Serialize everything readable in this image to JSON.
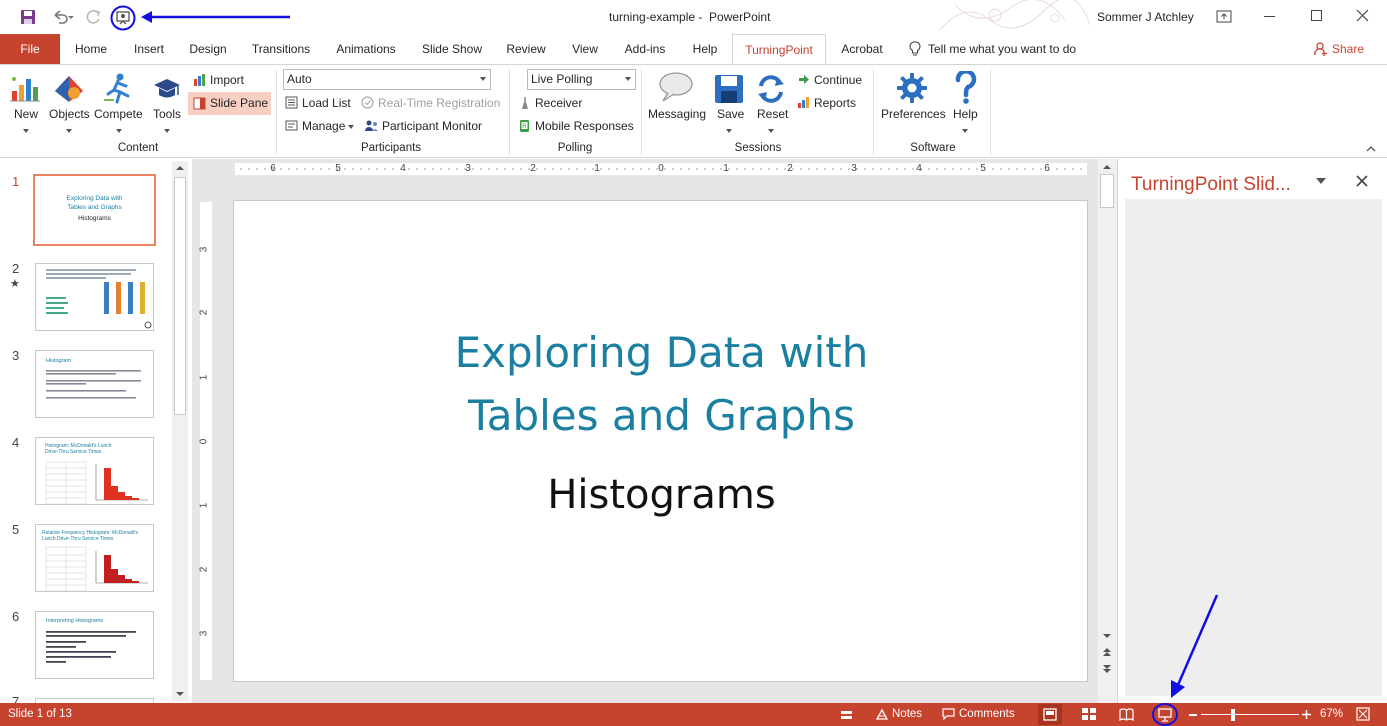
{
  "colors": {
    "accent": "#c6432e",
    "slide_title": "#1a7fa0",
    "annotation": "#1010e0"
  },
  "window": {
    "doc_name": "turning-example",
    "app_name": "PowerPoint",
    "user": "Sommer J Atchley"
  },
  "tabs": {
    "file": "File",
    "home": "Home",
    "insert": "Insert",
    "design": "Design",
    "transitions": "Transitions",
    "animations": "Animations",
    "slideshow": "Slide Show",
    "review": "Review",
    "view": "View",
    "addins": "Add-ins",
    "help": "Help",
    "turningpoint": "TurningPoint",
    "acrobat": "Acrobat",
    "tellme": "Tell me what you want to do",
    "share": "Share"
  },
  "ribbon": {
    "content": {
      "new": "New",
      "objects": "Objects",
      "compete": "Compete",
      "tools": "Tools",
      "import": "Import",
      "slide_pane": "Slide Pane",
      "group": "Content"
    },
    "participants": {
      "combo_value": "Auto",
      "load_list": "Load List",
      "realtime": "Real-Time Registration",
      "manage": "Manage",
      "monitor": "Participant Monitor",
      "group": "Participants"
    },
    "polling": {
      "combo_value": "Live Polling",
      "receiver": "Receiver",
      "mobile": "Mobile Responses",
      "group": "Polling"
    },
    "sessions": {
      "messaging": "Messaging",
      "save": "Save",
      "reset": "Reset",
      "continue": "Continue",
      "reports": "Reports",
      "group": "Sessions"
    },
    "software": {
      "preferences": "Preferences",
      "help": "Help",
      "group": "Software"
    }
  },
  "thumbnails": {
    "nums": [
      "1",
      "2",
      "3",
      "4",
      "5",
      "6",
      "7"
    ],
    "t1_title": "Exploring Data with Tables and Graphs",
    "t1_sub": "Histograms",
    "t3_title": "Histogram",
    "t4_title": "Histogram: McDonald's Lunch Drive-Thru Service Times",
    "t5_title": "Relative Frequency Histogram: McDonald's Lunch Drive-Thru Service Times",
    "t6_title": "Interpreting Histograms"
  },
  "ruler": {
    "h_ticks": [
      "6",
      "5",
      "4",
      "3",
      "2",
      "1",
      "0",
      "1",
      "2",
      "3",
      "4",
      "5",
      "6"
    ],
    "v_ticks": [
      "3",
      "2",
      "1",
      "0",
      "1",
      "2",
      "3"
    ]
  },
  "slide": {
    "title_line1": "Exploring Data with",
    "title_line2": "Tables and Graphs",
    "subtitle": "Histograms"
  },
  "taskpane": {
    "title": "TurningPoint Slid..."
  },
  "status": {
    "slide_info": "Slide 1 of 13",
    "notes": "Notes",
    "comments": "Comments",
    "zoom": "67%"
  }
}
